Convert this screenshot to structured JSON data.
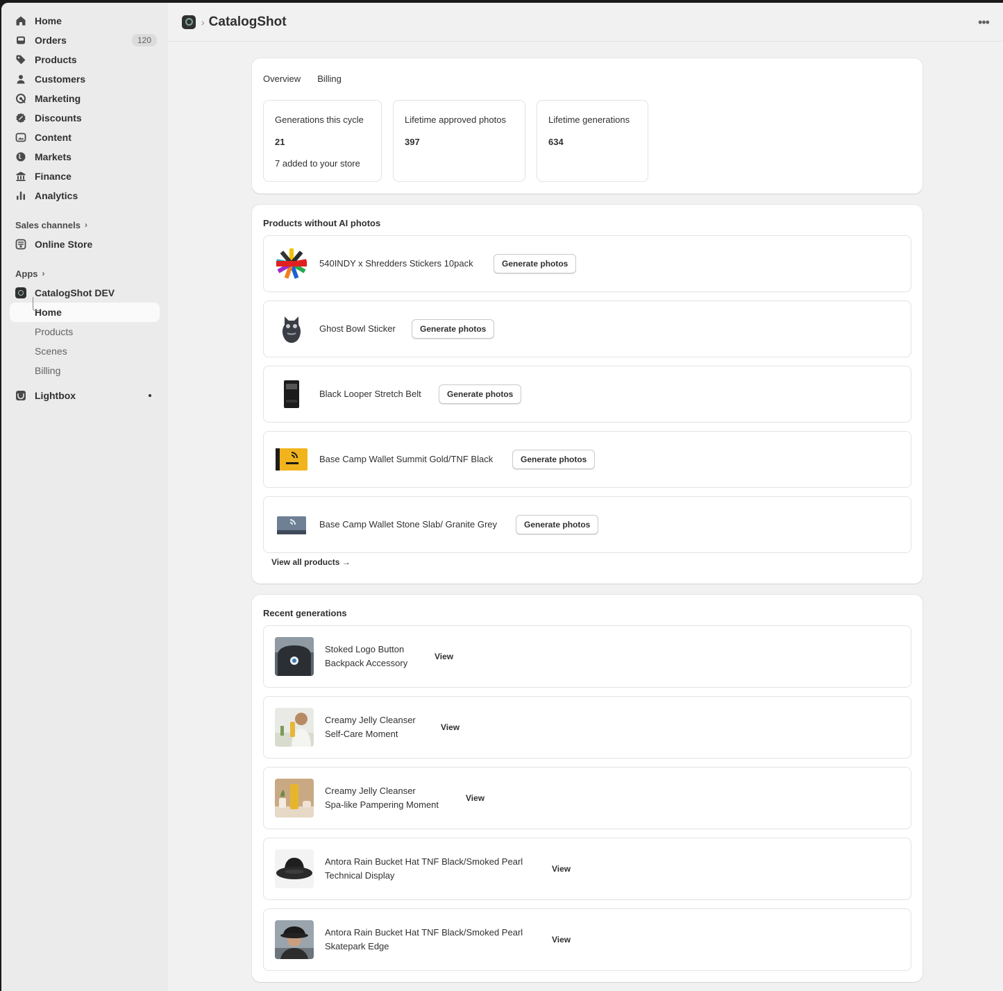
{
  "sidebar": {
    "items": [
      {
        "label": "Home",
        "icon": "home-icon"
      },
      {
        "label": "Orders",
        "icon": "orders-icon",
        "badge": "120"
      },
      {
        "label": "Products",
        "icon": "tag-icon"
      },
      {
        "label": "Customers",
        "icon": "person-icon"
      },
      {
        "label": "Marketing",
        "icon": "target-icon"
      },
      {
        "label": "Discounts",
        "icon": "discount-icon"
      },
      {
        "label": "Content",
        "icon": "image-icon"
      },
      {
        "label": "Markets",
        "icon": "globe-icon"
      },
      {
        "label": "Finance",
        "icon": "bank-icon"
      },
      {
        "label": "Analytics",
        "icon": "chart-icon"
      }
    ],
    "sales_channels": {
      "label": "Sales channels",
      "items": [
        {
          "label": "Online Store"
        }
      ]
    },
    "apps": {
      "label": "Apps",
      "app_name": "CatalogShot DEV",
      "sub_items": [
        {
          "label": "Home"
        },
        {
          "label": "Products"
        },
        {
          "label": "Scenes"
        },
        {
          "label": "Billing"
        }
      ],
      "other_app": "Lightbox"
    }
  },
  "header": {
    "title": "CatalogShot",
    "separator": "›"
  },
  "overview": {
    "tabs": [
      {
        "label": "Overview"
      },
      {
        "label": "Billing"
      }
    ],
    "stats": [
      {
        "label": "Generations this cycle",
        "value": "21",
        "sub": "7 added to your store"
      },
      {
        "label": "Lifetime approved photos",
        "value": "397"
      },
      {
        "label": "Lifetime generations",
        "value": "634"
      }
    ]
  },
  "products_without_ai": {
    "title": "Products without AI photos",
    "button_label": "Generate photos",
    "items": [
      {
        "name": "540INDY x Shredders Stickers 10pack"
      },
      {
        "name": "Ghost Bowl Sticker"
      },
      {
        "name": "Black Looper Stretch Belt"
      },
      {
        "name": "Base Camp Wallet Summit Gold/TNF Black"
      },
      {
        "name": "Base Camp Wallet Stone Slab/ Granite Grey"
      }
    ],
    "view_all": "View all products →"
  },
  "recent_generations": {
    "title": "Recent generations",
    "view_label": "View",
    "items": [
      {
        "line1": "Stoked Logo Button",
        "line2": "Backpack Accessory"
      },
      {
        "line1": "Creamy Jelly Cleanser",
        "line2": "Self-Care Moment"
      },
      {
        "line1": "Creamy Jelly Cleanser",
        "line2": "Spa-like Pampering Moment"
      },
      {
        "line1": "Antora Rain Bucket Hat TNF Black/Smoked Pearl",
        "line2": "Technical Display"
      },
      {
        "line1": "Antora Rain Bucket Hat TNF Black/Smoked Pearl",
        "line2": "Skatepark Edge"
      }
    ]
  }
}
